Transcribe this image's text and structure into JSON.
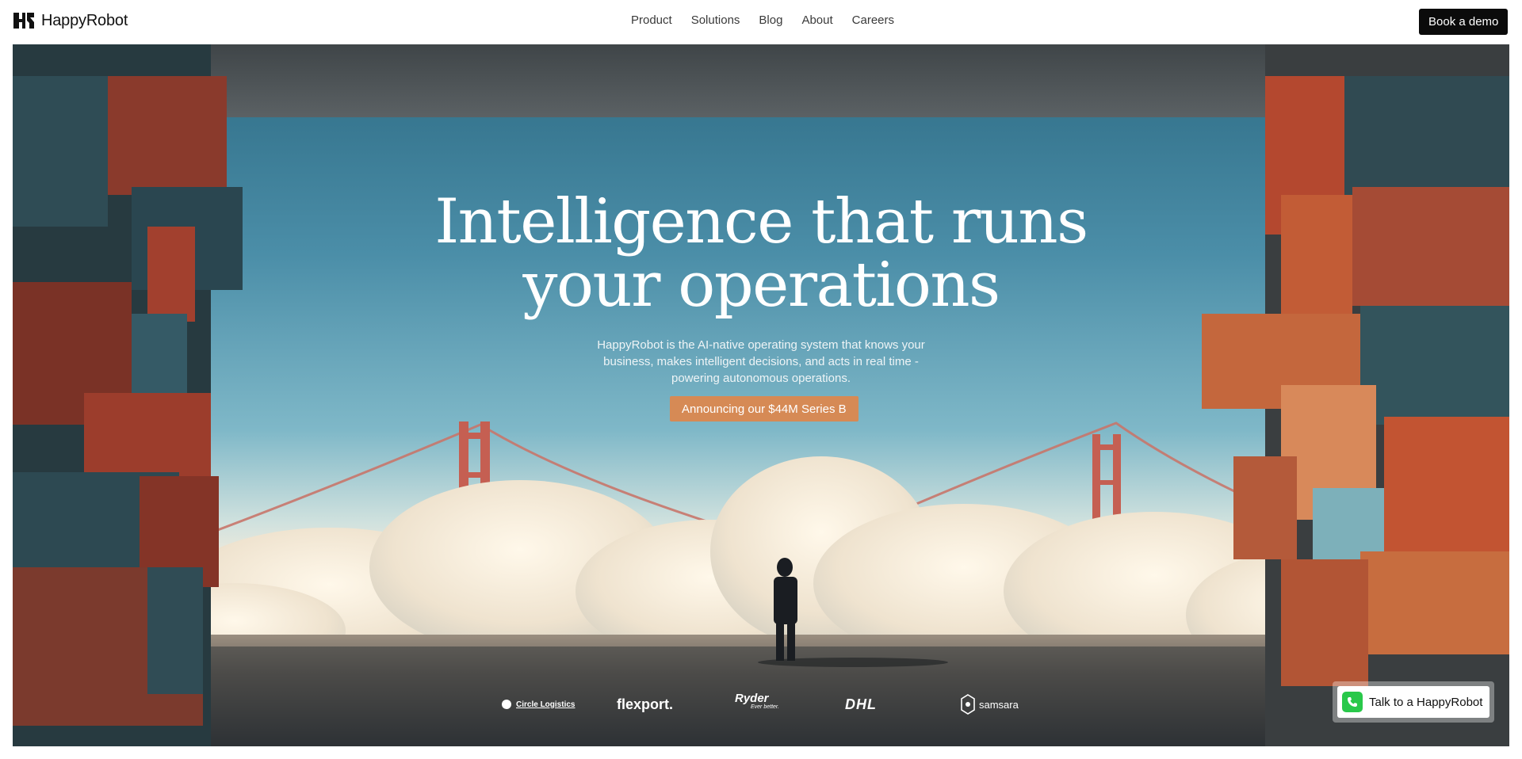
{
  "header": {
    "brand": "HappyRobot",
    "nav": [
      "Product",
      "Solutions",
      "Blog",
      "About",
      "Careers"
    ],
    "cta_label": "Book a demo"
  },
  "hero": {
    "headline_line1": "Intelligence that runs",
    "headline_line2": "your operations",
    "subhead_line1": "HappyRobot is the AI-native operating system that knows your",
    "subhead_line2": "business, makes intelligent decisions, and acts in real time -",
    "subhead_line3": "powering autonomous operations.",
    "announcement_label": "Announcing our $44M Series B"
  },
  "logos": [
    "Circle Logistics",
    "flexport.",
    "Ryder",
    "Ever better.",
    "DHL",
    "samsara"
  ],
  "chat_widget": {
    "label": "Talk to a HappyRobot",
    "icon": "phone-icon"
  },
  "colors": {
    "cta_bg": "#0b0b0b",
    "announcement_bg": "#d68a55",
    "phone_green": "#29c84a"
  }
}
